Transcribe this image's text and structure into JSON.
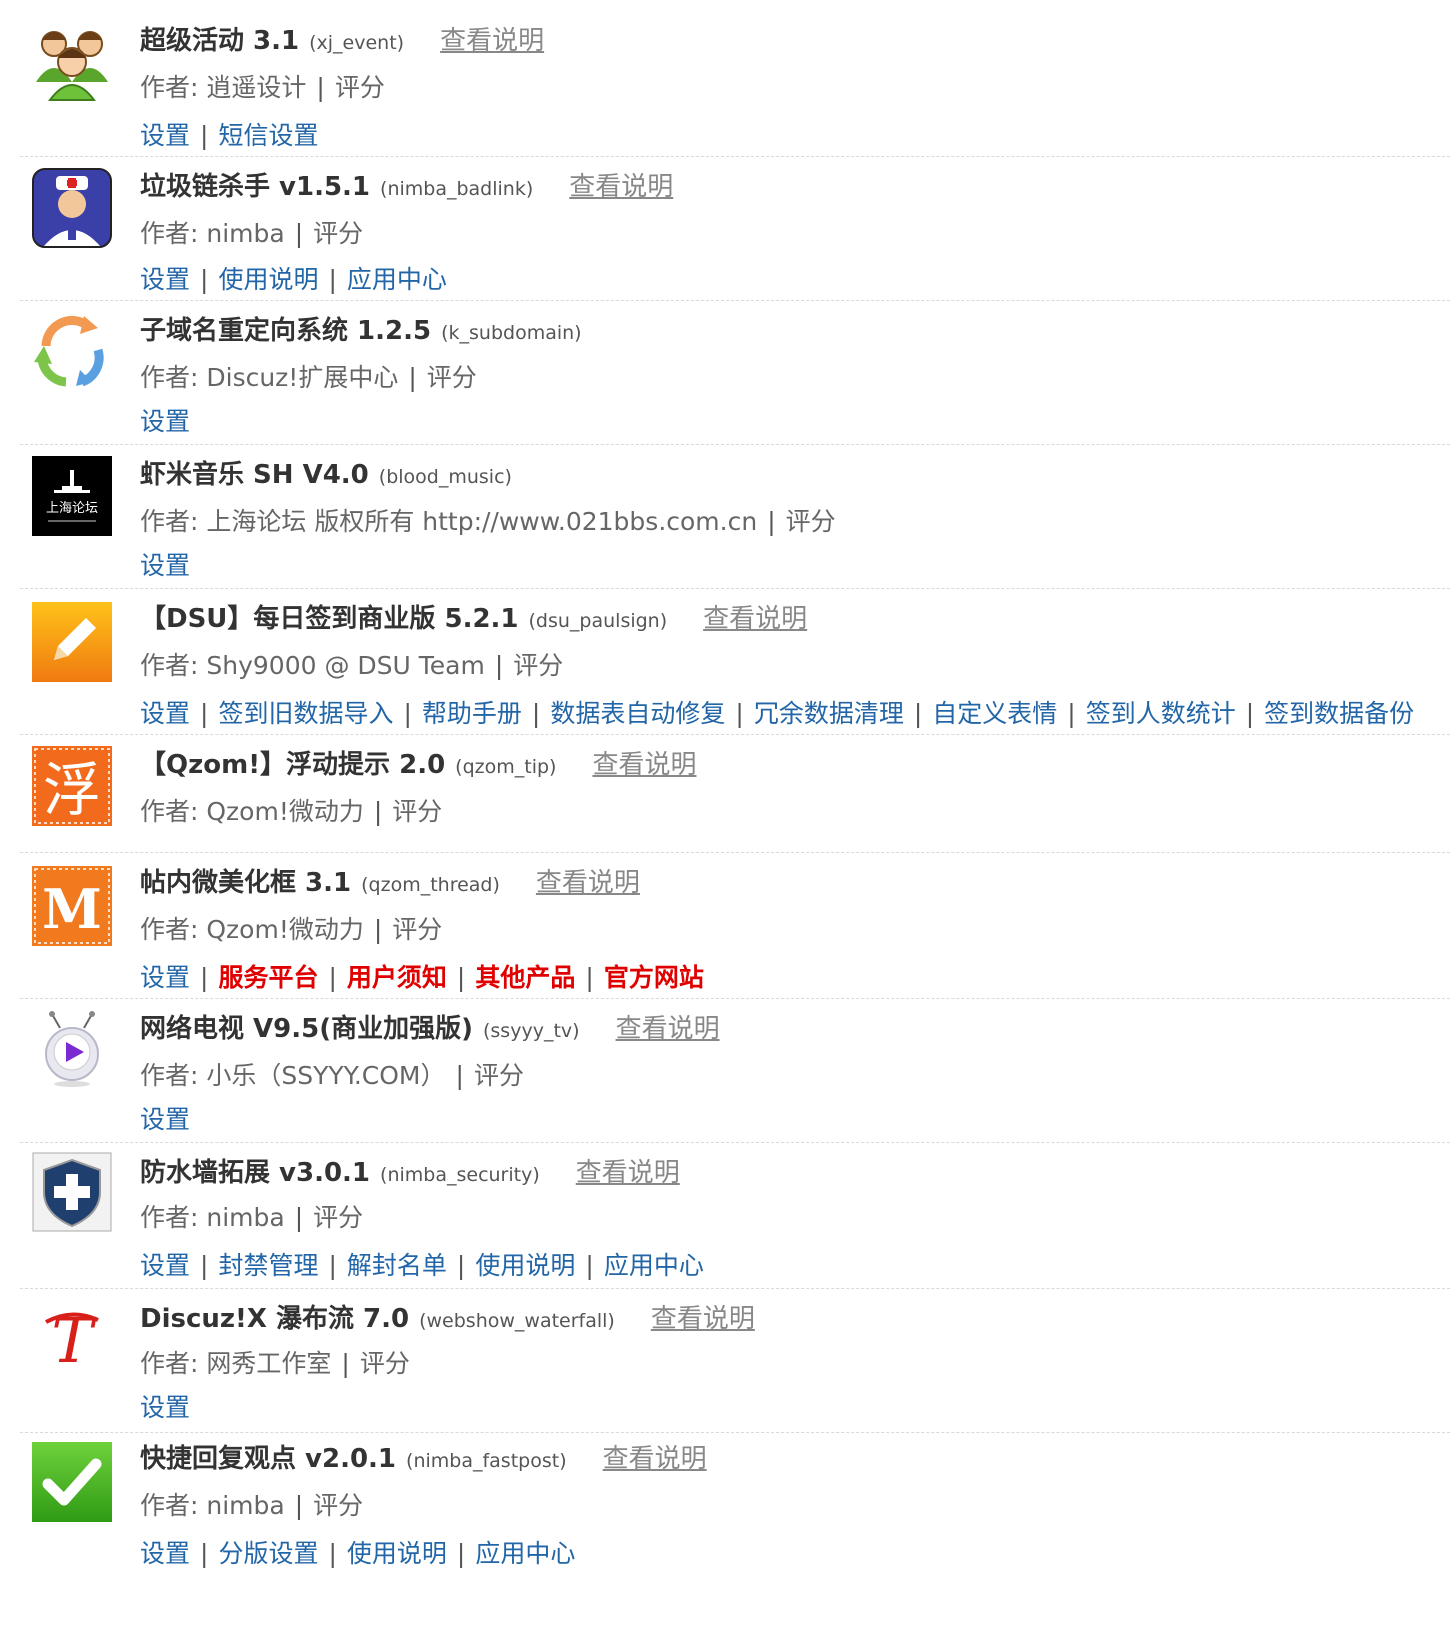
{
  "plugins": [
    {
      "name": "超级活动 3.1",
      "id": "(xj_event)",
      "desc": "查看说明",
      "author_label": "作者: 逍遥设计",
      "rating": "评分",
      "links": [
        "设置",
        "短信设置"
      ],
      "red_links": []
    },
    {
      "name": "垃圾链杀手 v1.5.1",
      "id": "(nimba_badlink)",
      "desc": "查看说明",
      "author_label": "作者: nimba",
      "rating": "评分",
      "links": [
        "设置",
        "使用说明",
        "应用中心"
      ],
      "red_links": []
    },
    {
      "name": "子域名重定向系统 1.2.5",
      "id": "(k_subdomain)",
      "desc": "",
      "author_label": "作者: Discuz!扩展中心",
      "rating": "评分",
      "links": [
        "设置"
      ],
      "red_links": []
    },
    {
      "name": "虾米音乐 SH V4.0",
      "id": "(blood_music)",
      "desc": "",
      "author_label": "作者: 上海论坛 版权所有 http://www.021bbs.com.cn",
      "rating": "评分",
      "links": [
        "设置"
      ],
      "red_links": []
    },
    {
      "name": "【DSU】每日签到商业版 5.2.1",
      "id": "(dsu_paulsign)",
      "desc": "查看说明",
      "author_label": "作者: Shy9000 @ DSU Team",
      "rating": "评分",
      "links": [
        "设置",
        "签到旧数据导入",
        "帮助手册",
        "数据表自动修复",
        "冗余数据清理",
        "自定义表情",
        "签到人数统计",
        "签到数据备份"
      ],
      "red_links": []
    },
    {
      "name": "【Qzom!】浮动提示 2.0",
      "id": "(qzom_tip)",
      "desc": "查看说明",
      "author_label": "作者: Qzom!微动力",
      "rating": "评分",
      "links": [],
      "red_links": []
    },
    {
      "name": "帖内微美化框 3.1",
      "id": "(qzom_thread)",
      "desc": "查看说明",
      "author_label": "作者: Qzom!微动力",
      "rating": "评分",
      "links": [
        "设置"
      ],
      "red_links": [
        "服务平台",
        "用户须知",
        "其他产品",
        "官方网站"
      ]
    },
    {
      "name": "网络电视 V9.5(商业加强版)",
      "id": "(ssyyy_tv)",
      "desc": "查看说明",
      "author_label": "作者: 小乐（SSYYY.COM）",
      "rating": "评分",
      "links": [
        "设置"
      ],
      "red_links": []
    },
    {
      "name": "防水墙拓展 v3.0.1",
      "id": "(nimba_security)",
      "desc": "查看说明",
      "author_label": "作者: nimba",
      "rating": "评分",
      "links": [
        "设置",
        "封禁管理",
        "解封名单",
        "使用说明",
        "应用中心"
      ],
      "red_links": []
    },
    {
      "name": "Discuz!X 瀑布流 7.0",
      "id": "(webshow_waterfall)",
      "desc": "查看说明",
      "author_label": "作者: 网秀工作室",
      "rating": "评分",
      "links": [
        "设置"
      ],
      "red_links": []
    },
    {
      "name": "快捷回复观点 v2.0.1",
      "id": "(nimba_fastpost)",
      "desc": "查看说明",
      "author_label": "作者: nimba",
      "rating": "评分",
      "links": [
        "设置",
        "分版设置",
        "使用说明",
        "应用中心"
      ],
      "red_links": []
    }
  ],
  "icons": [
    "users-group-icon",
    "doctor-icon",
    "refresh-arrows-icon",
    "shanghai-forum-logo-icon",
    "pencil-icon",
    "fu-character-icon",
    "m-letter-icon",
    "tv-play-icon",
    "shield-plus-icon",
    "script-t-icon",
    "checkmark-icon"
  ],
  "icon_texts": {
    "fu": "浮",
    "m": "M",
    "t": "T",
    "sh": "上海论坛"
  },
  "colors": {
    "link": "#2366a8",
    "red_link": "#e00000",
    "text": "#333333",
    "meta": "#666666"
  }
}
